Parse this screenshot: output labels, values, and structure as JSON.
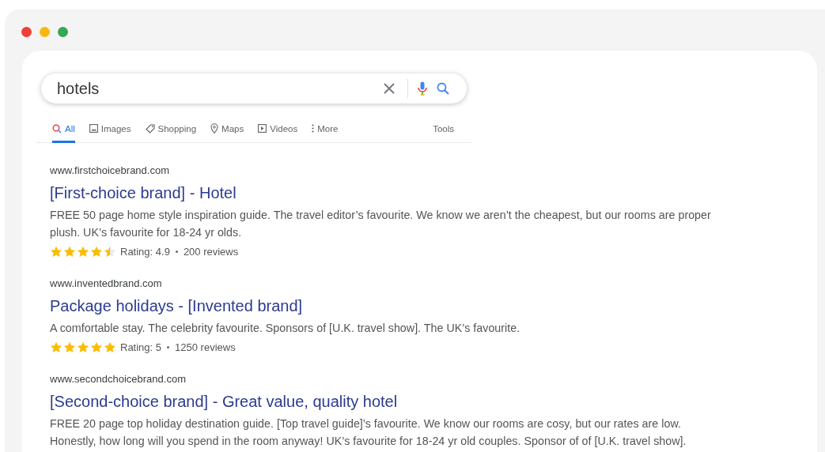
{
  "search": {
    "value": "hotels"
  },
  "tabs": [
    {
      "label": "All",
      "selected": true
    },
    {
      "label": "Images",
      "selected": false
    },
    {
      "label": "Shopping",
      "selected": false
    },
    {
      "label": "Maps",
      "selected": false
    },
    {
      "label": "Videos",
      "selected": false
    },
    {
      "label": "More",
      "selected": false
    }
  ],
  "tools": "Tools",
  "results": [
    {
      "url": "www.firstchoicebrand.com",
      "title": "[First-choice brand] - Hotel",
      "snippet": "FREE 50 page home style inspiration guide. The travel editor’s favourite. We know we aren’t the cheapest, but our rooms are proper plush. UK’s favourite for 18-24 yr olds.",
      "stars": 4.5,
      "rating": "Rating: 4.9",
      "reviews": "200 reviews"
    },
    {
      "url": "www.inventedbrand.com",
      "title": "Package holidays - [Invented brand]",
      "snippet": "A comfortable stay. The celebrity favourite. Sponsors of [U.K. travel show]. The UK’s favourite.",
      "stars": 5,
      "rating": "Rating: 5",
      "reviews": "1250 reviews"
    },
    {
      "url": "www.secondchoicebrand.com",
      "title": "[Second-choice brand] - Great value, quality hotel",
      "snippet": "FREE 20 page top holiday destination guide. [Top travel guide]’s favourite. We know our rooms are cosy, but our rates are low. Honestly, how long will you spend in the room anyway! UK’s favourite for 18-24 yr old couples. Sponsor of of [U.K. travel show]."
    }
  ]
}
